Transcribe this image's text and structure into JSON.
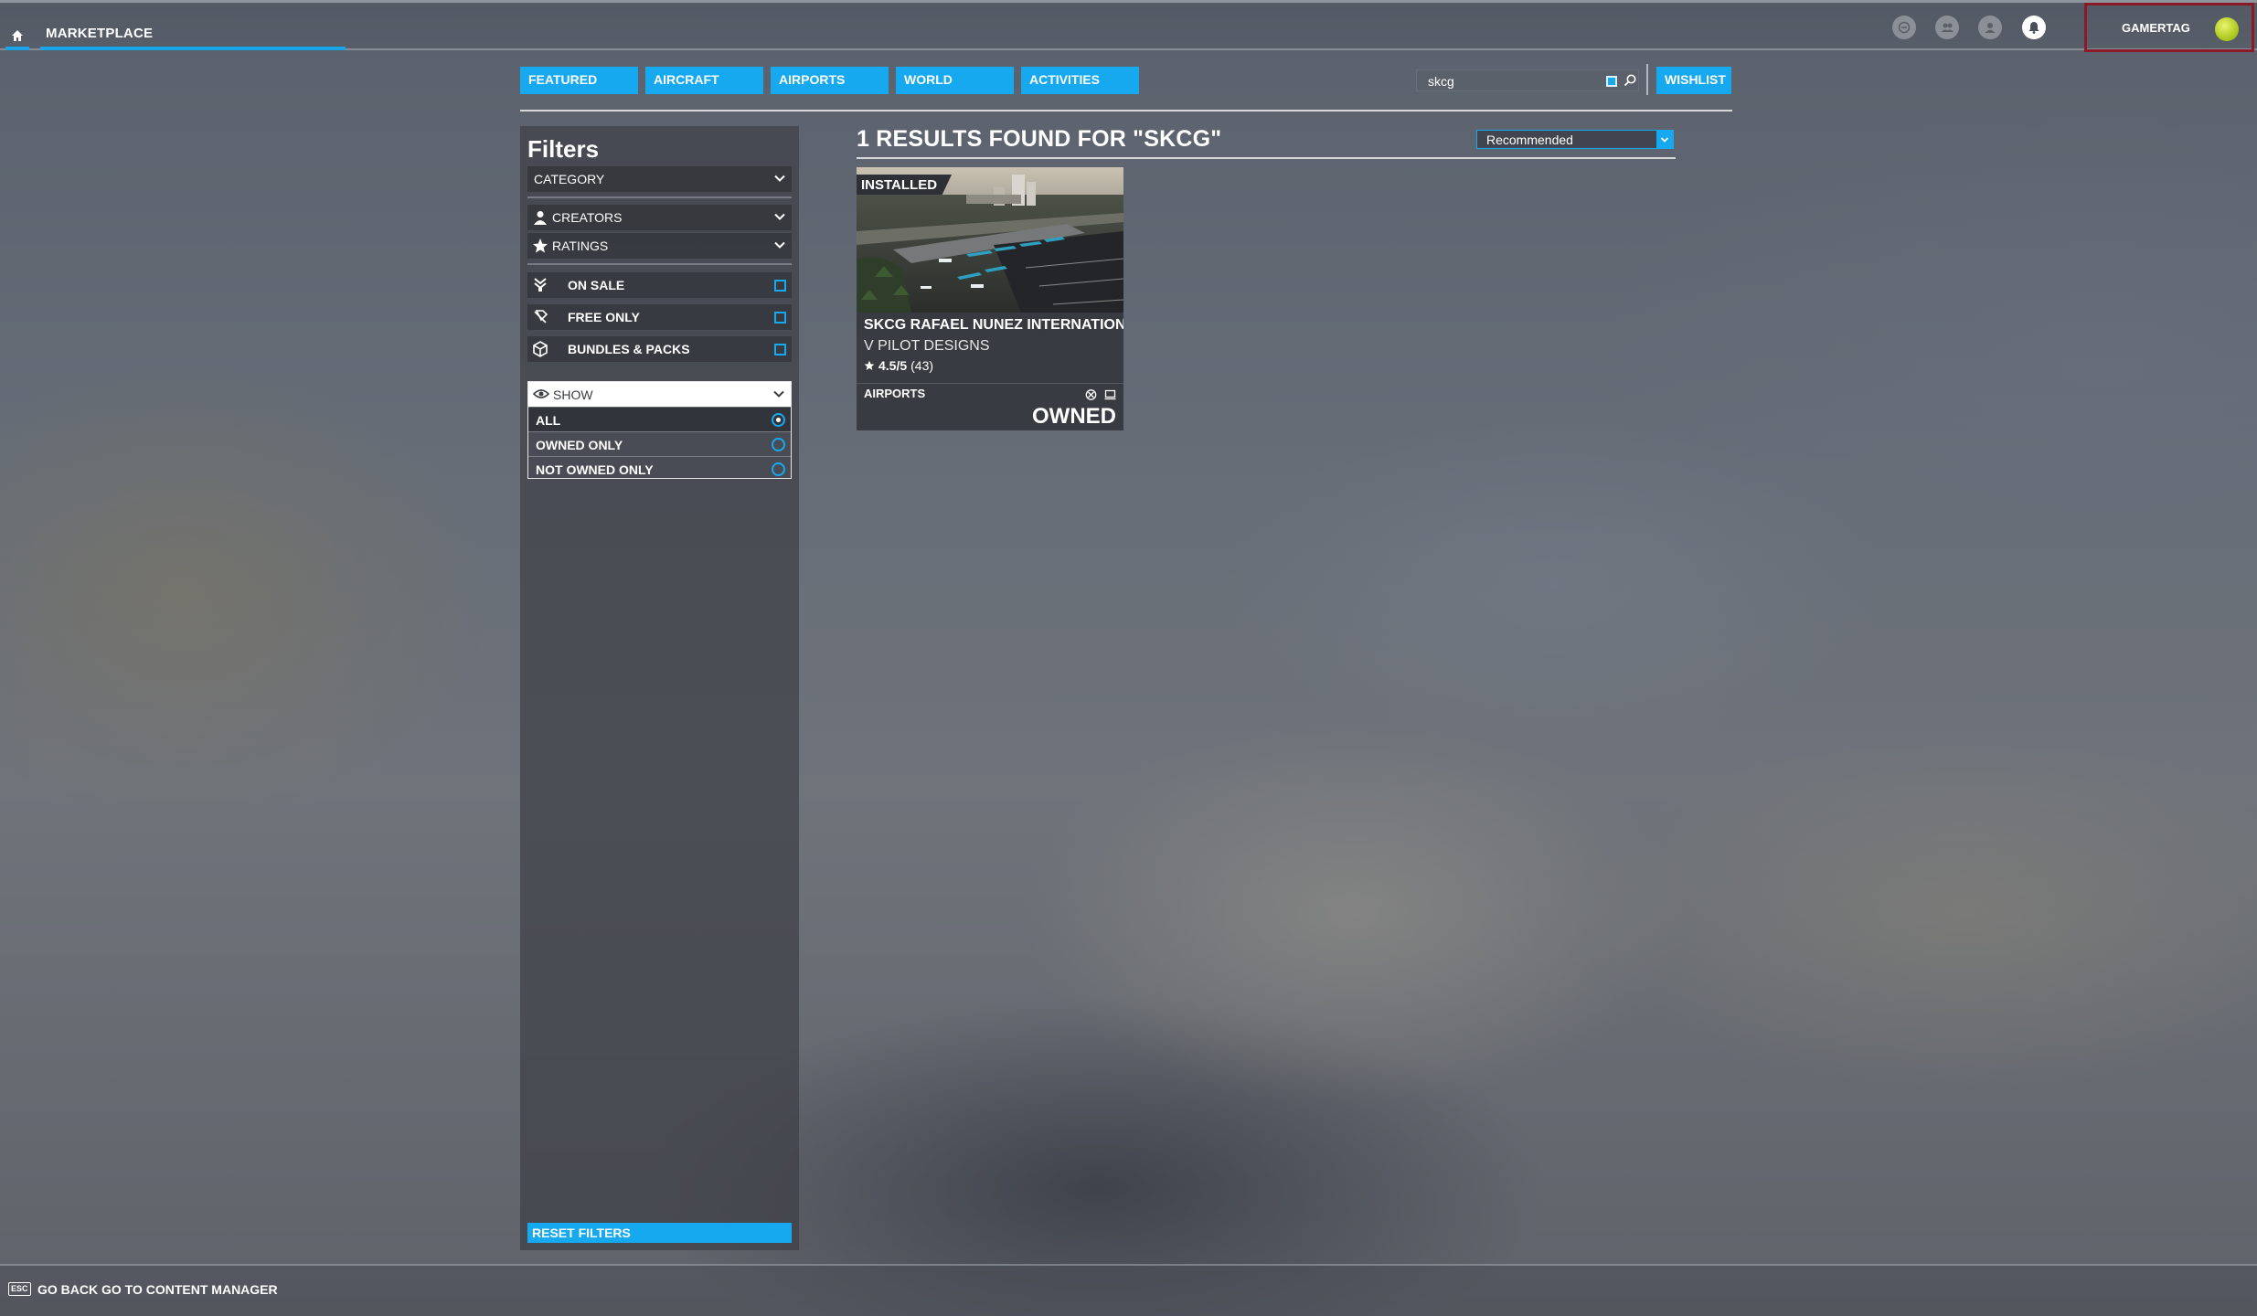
{
  "topbar": {
    "section_title": "MARKETPLACE",
    "gamertag": "GAMERTAG",
    "icons": [
      "marketplace-icon",
      "friends-icon",
      "profile-icon",
      "notifications-icon"
    ]
  },
  "tabs": [
    {
      "label": "FEATURED"
    },
    {
      "label": "AIRCRAFT"
    },
    {
      "label": "AIRPORTS"
    },
    {
      "label": "WORLD"
    },
    {
      "label": "ACTIVITIES"
    }
  ],
  "search": {
    "value": "skcg",
    "placeholder": ""
  },
  "wishlist_label": "WISHLIST",
  "filters": {
    "title": "Filters",
    "category": "CATEGORY",
    "creators": "CREATORS",
    "ratings": "RATINGS",
    "on_sale": "ON SALE",
    "free_only": "FREE ONLY",
    "bundles": "BUNDLES & PACKS",
    "show": "SHOW",
    "show_options": [
      {
        "label": "ALL",
        "selected": true
      },
      {
        "label": "OWNED ONLY",
        "selected": false
      },
      {
        "label": "NOT OWNED ONLY",
        "selected": false
      }
    ],
    "reset_label": "RESET FILTERS"
  },
  "results": {
    "title": "1 RESULTS FOUND FOR \"SKCG\"",
    "sort": "Recommended"
  },
  "card": {
    "badge": "INSTALLED",
    "name": "SKCG RAFAEL NUNEZ INTERNATIONAL",
    "creator": "V PILOT DESIGNS",
    "rating": "4.5/5",
    "reviews": "(43)",
    "category": "AIRPORTS",
    "status": "OWNED"
  },
  "bottombar": {
    "esc": "ESC",
    "go_back": "GO BACK",
    "content_manager": "GO TO CONTENT MANAGER"
  },
  "colors": {
    "accent": "#17a9f0",
    "highlight_border": "#8b1a28"
  }
}
